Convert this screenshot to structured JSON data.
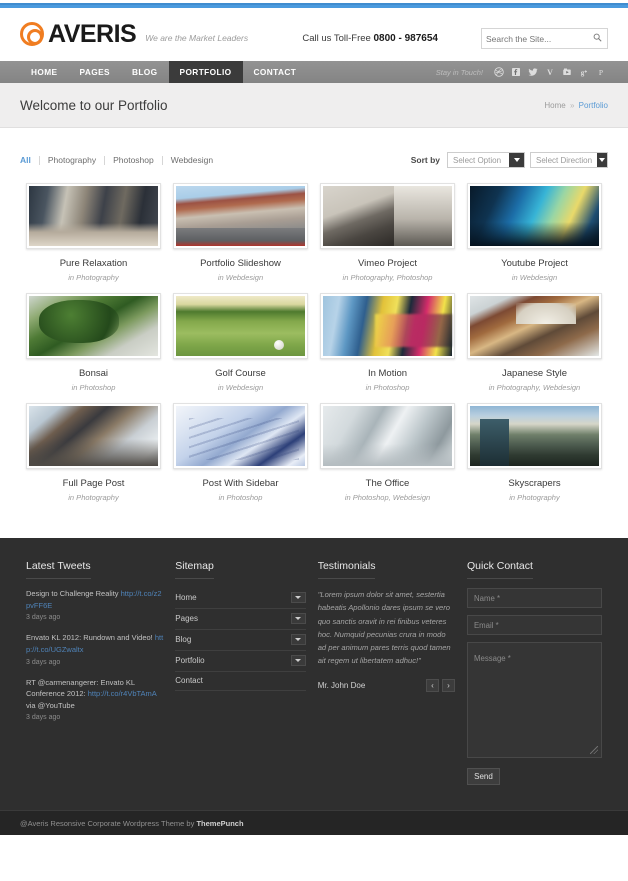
{
  "header": {
    "logo_text": "AVERIS",
    "logo_icon": "target-circles-logo-icon",
    "tagline": "We are the Market Leaders",
    "call_prefix": "Call us Toll-Free ",
    "call_number": "0800 - 987654",
    "search_placeholder": "Search the Site...",
    "search_value": ""
  },
  "nav": {
    "items": [
      {
        "label": "HOME",
        "active": false
      },
      {
        "label": "PAGES",
        "active": false
      },
      {
        "label": "BLOG",
        "active": false
      },
      {
        "label": "PORTFOLIO",
        "active": true
      },
      {
        "label": "CONTACT",
        "active": false
      }
    ],
    "stay_in_touch": "Stay in Touch!",
    "socials": [
      "dribbble-icon",
      "facebook-icon",
      "twitter-icon",
      "vimeo-icon",
      "youtube-icon",
      "google-plus-icon",
      "pinterest-icon"
    ]
  },
  "page": {
    "title": "Welcome to our Portfolio",
    "breadcrumb_home": "Home",
    "breadcrumb_sep": "»",
    "breadcrumb_current": "Portfolio"
  },
  "filters": {
    "items": [
      {
        "label": "All",
        "selected": true
      },
      {
        "label": "Photography",
        "selected": false
      },
      {
        "label": "Photoshop",
        "selected": false
      },
      {
        "label": "Webdesign",
        "selected": false
      }
    ],
    "sort_label": "Sort by",
    "sort_option": "Select Option",
    "sort_direction": "Select Direction"
  },
  "portfolio": {
    "items": [
      {
        "title": "Pure Relaxation",
        "meta": "in Photography",
        "img": "im1"
      },
      {
        "title": "Portfolio Slideshow",
        "meta": "in Webdesign",
        "img": "im2"
      },
      {
        "title": "Vimeo Project",
        "meta": "in Photography, Photoshop",
        "img": "im3"
      },
      {
        "title": "Youtube Project",
        "meta": "in Webdesign",
        "img": "im4"
      },
      {
        "title": "Bonsai",
        "meta": "in Photoshop",
        "img": "im5"
      },
      {
        "title": "Golf Course",
        "meta": "in Webdesign",
        "img": "im6"
      },
      {
        "title": "In Motion",
        "meta": "in Photoshop",
        "img": "im7"
      },
      {
        "title": "Japanese Style",
        "meta": "in Photography, Webdesign",
        "img": "im8"
      },
      {
        "title": "Full Page Post",
        "meta": "in Photography",
        "img": "im9"
      },
      {
        "title": "Post With Sidebar",
        "meta": "in Photoshop",
        "img": "im10"
      },
      {
        "title": "The Office",
        "meta": "in Photoshop, Webdesign",
        "img": "im11"
      },
      {
        "title": "Skyscrapers",
        "meta": "in Photography",
        "img": "im12"
      }
    ]
  },
  "footer": {
    "tweets": {
      "title": "Latest Tweets",
      "items": [
        {
          "text": "Design to Challenge Reality ",
          "link": "http://t.co/z2pvFF6E",
          "ago": "3 days ago"
        },
        {
          "text": "Envato KL 2012: Rundown and Video! ",
          "link": "http://t.co/UGZwaltx",
          "ago": "3 days ago"
        },
        {
          "text": "RT @carmenangerer: Envato KL Conference 2012: ",
          "link": "http://t.co/r4VbTAmA",
          "text_after": " via @YouTube",
          "ago": "3 days ago"
        }
      ]
    },
    "sitemap": {
      "title": "Sitemap",
      "items": [
        {
          "label": "Home",
          "has_children": true
        },
        {
          "label": "Pages",
          "has_children": true
        },
        {
          "label": "Blog",
          "has_children": true
        },
        {
          "label": "Portfolio",
          "has_children": true
        },
        {
          "label": "Contact",
          "has_children": false
        }
      ]
    },
    "testimonials": {
      "title": "Testimonials",
      "quote": "\"Lorem ipsum dolor sit amet, sestertia habeatis Apollonio dares ipsum se vero quo sanctis oravit in rei finibus veteres hoc. Numquid pecunias crura in modo ad per animum pares terris quod tamen ait regem ut libertatem adhuc!\"",
      "author": "Mr. John Doe",
      "prev": "‹",
      "next": "›"
    },
    "contact": {
      "title": "Quick Contact",
      "name_placeholder": "Name *",
      "email_placeholder": "Email *",
      "message_placeholder": "Message *",
      "send_label": "Send"
    },
    "copyright_prefix": "@Averis Resonsive Corporate Wordpress Theme by ",
    "copyright_brand": "ThemePunch"
  },
  "colors": {
    "accent_orange": "#f07d21",
    "link_blue": "#5b9bd5",
    "nav_bg": "#8a8a8a",
    "nav_active": "#3b3b3b",
    "footer_bg": "#2f2f2f",
    "top_stripe": "#4a9ade"
  }
}
